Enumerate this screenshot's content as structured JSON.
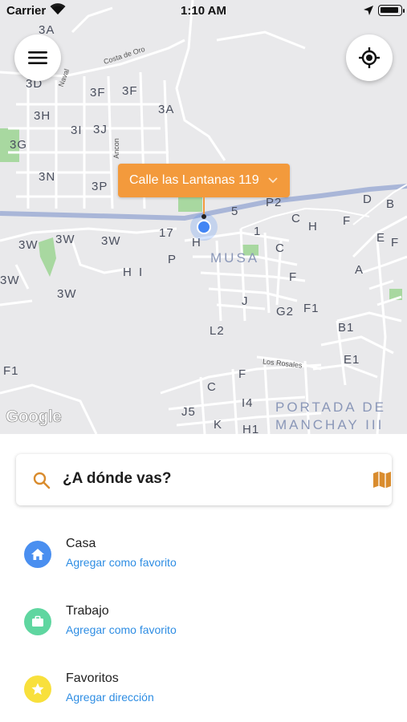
{
  "status_bar": {
    "carrier": "Carrier",
    "time": "1:10 AM"
  },
  "map": {
    "pin_address": "Calle las Lantanas 119",
    "attribution": "Google",
    "district_labels": [
      "MUSA",
      "PORTADA DE",
      "MANCHAY III"
    ],
    "block_labels": [
      "3A",
      "3D",
      "3F",
      "3F",
      "3A",
      "3H",
      "3I",
      "3J",
      "3G",
      "3N",
      "3P",
      "5",
      "P2",
      "D",
      "B",
      "C",
      "H",
      "F",
      "E",
      "F",
      "3W",
      "3W",
      "3W",
      "17",
      "H",
      "1",
      "C",
      "P",
      "H",
      "I",
      "A",
      "3W",
      "3W",
      "F",
      "J",
      "G2",
      "F1",
      "L2",
      "B1",
      "E1",
      "F1",
      "F",
      "C",
      "I4",
      "J5",
      "K",
      "H1"
    ],
    "street_labels": [
      "Costa de Oro",
      "Ancon",
      "Los Rosales",
      "Naval"
    ],
    "colors": {
      "background": "#e9e9eb",
      "main_road": "#a9b6d8",
      "park": "#a8d8a0",
      "accent_orange": "#f39a3c",
      "user_location": "#4285f4"
    }
  },
  "search": {
    "placeholder": "¿A dónde vas?"
  },
  "shortcuts": [
    {
      "title": "Casa",
      "subtitle": "Agregar como favorito",
      "icon": "home-icon",
      "color": "#4a8ff0"
    },
    {
      "title": "Trabajo",
      "subtitle": "Agregar como favorito",
      "icon": "briefcase-icon",
      "color": "#5fd6a0"
    },
    {
      "title": "Favoritos",
      "subtitle": "Agregar dirección",
      "icon": "star-icon",
      "color": "#f8e03c"
    }
  ]
}
